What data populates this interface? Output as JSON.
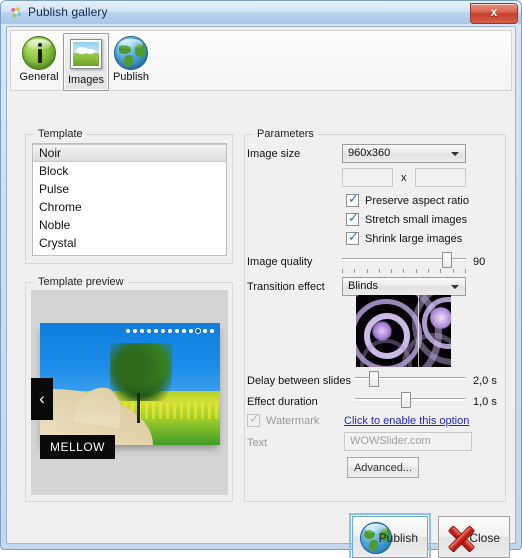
{
  "window": {
    "title": "Publish gallery",
    "app_icon": "flower-icon",
    "close_label": "x"
  },
  "toolbar": {
    "items": [
      {
        "label": "General",
        "icon": "info-globe-icon",
        "selected": false
      },
      {
        "label": "Images",
        "icon": "picture-icon",
        "selected": true
      },
      {
        "label": "Publish",
        "icon": "globe-icon",
        "selected": false
      }
    ]
  },
  "template_group": {
    "legend": "Template",
    "items": [
      "Noir",
      "Block",
      "Pulse",
      "Chrome",
      "Noble",
      "Crystal"
    ],
    "selected_index": 0
  },
  "preview_group": {
    "legend": "Template preview",
    "caption": "MELLOW",
    "prev_arrow": "‹",
    "next_arrow": "›",
    "dot_count": 13,
    "active_dot_index": 10
  },
  "parameters": {
    "legend": "Parameters",
    "image_size": {
      "label": "Image size",
      "value": "960x360",
      "width_value": "",
      "height_value": "",
      "separator": "x"
    },
    "checkboxes": [
      {
        "label": "Preserve aspect ratio",
        "checked": true,
        "enabled": true
      },
      {
        "label": "Stretch small images",
        "checked": true,
        "enabled": true
      },
      {
        "label": "Shrink large images",
        "checked": true,
        "enabled": true
      }
    ],
    "image_quality": {
      "label": "Image quality",
      "value": "90",
      "percent": 88,
      "tick_count": 11
    },
    "transition_effect": {
      "label": "Transition effect",
      "value": "Blinds"
    },
    "delay_between_slides": {
      "label": "Delay between slides",
      "value": "2,0 s",
      "percent": 14
    },
    "effect_duration": {
      "label": "Effect duration",
      "value": "1,0 s",
      "percent": 46
    },
    "watermark": {
      "label": "Watermark",
      "checked": true,
      "enabled": false,
      "link": "Click to enable this option"
    },
    "text": {
      "label": "Text",
      "value": "WOWSlider.com"
    },
    "advanced_button": "Advanced..."
  },
  "footer": {
    "publish_label": "Publish",
    "close_label": "Close"
  },
  "colors": {
    "accent": "#2a6fba",
    "link": "#2424cd",
    "title_text": "#0d2a47",
    "close_red": "#c5402c"
  }
}
